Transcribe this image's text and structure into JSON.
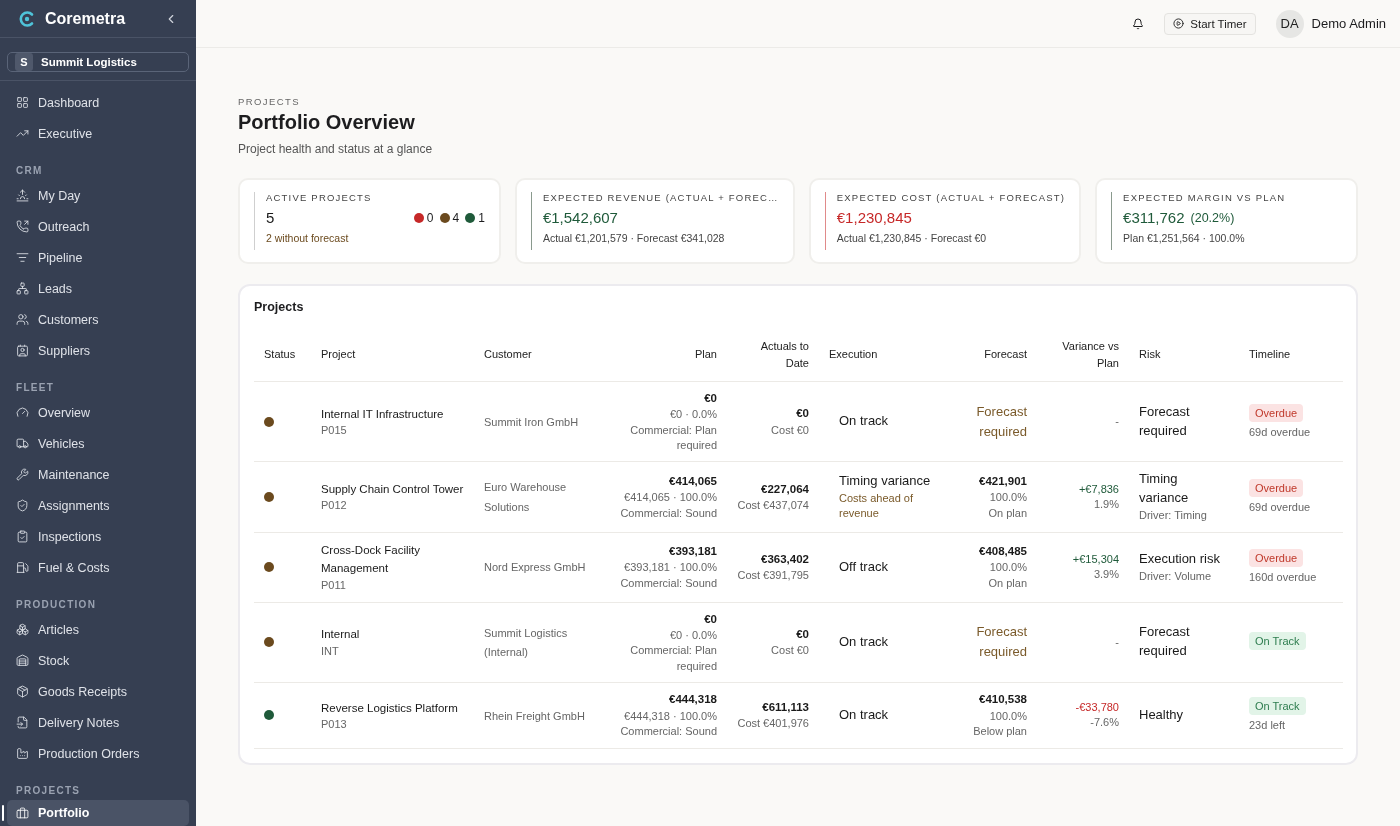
{
  "sidebar": {
    "brand": "Coremetra",
    "org": {
      "initial": "S",
      "name": "Summit Logistics"
    },
    "sections": [
      {
        "items": [
          {
            "label": "Dashboard",
            "selected": false
          },
          {
            "label": "Executive",
            "selected": false
          }
        ]
      },
      {
        "title": "CRM",
        "items": [
          {
            "label": "My Day",
            "selected": false
          },
          {
            "label": "Outreach",
            "selected": false
          },
          {
            "label": "Pipeline",
            "selected": false
          },
          {
            "label": "Leads",
            "selected": false
          },
          {
            "label": "Customers",
            "selected": false
          },
          {
            "label": "Suppliers",
            "selected": false
          }
        ]
      },
      {
        "title": "FLEET",
        "items": [
          {
            "label": "Overview",
            "selected": false
          },
          {
            "label": "Vehicles",
            "selected": false
          },
          {
            "label": "Maintenance",
            "selected": false
          },
          {
            "label": "Assignments",
            "selected": false
          },
          {
            "label": "Inspections",
            "selected": false
          },
          {
            "label": "Fuel & Costs",
            "selected": false
          }
        ]
      },
      {
        "title": "PRODUCTION",
        "items": [
          {
            "label": "Articles",
            "selected": false
          },
          {
            "label": "Stock",
            "selected": false
          },
          {
            "label": "Goods Receipts",
            "selected": false
          },
          {
            "label": "Delivery Notes",
            "selected": false
          },
          {
            "label": "Production Orders",
            "selected": false
          }
        ]
      },
      {
        "title": "PROJECTS",
        "items": [
          {
            "label": "Portfolio",
            "selected": true
          }
        ]
      }
    ]
  },
  "header": {
    "timer": "Start Timer",
    "user": {
      "initials": "DA",
      "name": "Demo Admin"
    }
  },
  "page": {
    "eyebrow": "PROJECTS",
    "title": "Portfolio Overview",
    "subtitle": "Project health and status at a glance"
  },
  "kpis": [
    {
      "kind": "count",
      "label": "ACTIVE PROJECTS",
      "value": "5",
      "dots": [
        {
          "color": "#c62828",
          "count": "0"
        },
        {
          "color": "#6b4a1e",
          "count": "4"
        },
        {
          "color": "#1f5a3a",
          "count": "1"
        }
      ],
      "note": "2 without forecast"
    },
    {
      "kind": "gain",
      "label": "EXPECTED REVENUE (ACTUAL + FOREC…",
      "value": "€1,542,607",
      "note": "Actual €1,201,579 · Forecast €341,028"
    },
    {
      "kind": "loss",
      "label": "EXPECTED COST (ACTUAL + FORECAST)",
      "value": "€1,230,845",
      "note": "Actual €1,230,845 · Forecast €0"
    },
    {
      "kind": "gain",
      "label": "EXPECTED MARGIN VS PLAN",
      "value": "€311,762",
      "extra": "(20.2%)",
      "note": "Plan €1,251,564 · 100.0%"
    }
  ],
  "table": {
    "title": "Projects",
    "columns": [
      "Status",
      "Project",
      "Customer",
      "Plan",
      "Actuals to Date",
      "Execution",
      "Forecast",
      "Variance vs Plan",
      "Risk",
      "Timeline"
    ],
    "rows": [
      {
        "color": "#6b4a1e",
        "project": "Internal IT Infrastructure",
        "code": "P015",
        "customer": "Summit Iron GmbH",
        "plan": {
          "total": "€0",
          "detail": "€0 · 0.0%",
          "commercial": "Commercial: Plan required"
        },
        "actuals": {
          "total": "€0",
          "cost": "Cost €0"
        },
        "execution": {
          "status": "On track"
        },
        "forecast": {
          "kind": "required",
          "text": "Forecast required"
        },
        "variance": {
          "kind": "none",
          "value": "-"
        },
        "risk": {
          "label": "Forecast required"
        },
        "timeline": {
          "badge": "Overdue",
          "kind": "overdue",
          "note": "69d overdue"
        }
      },
      {
        "color": "#6b4a1e",
        "project": "Supply Chain Control Tower",
        "code": "P012",
        "customer": "Euro Warehouse Solutions",
        "plan": {
          "total": "€414,065",
          "detail": "€414,065 · 100.0%",
          "commercial": "Commercial: Sound"
        },
        "actuals": {
          "total": "€227,064",
          "cost": "Cost €437,074"
        },
        "execution": {
          "status": "Timing variance",
          "note": "Costs ahead of revenue"
        },
        "forecast": {
          "kind": "value",
          "total": "€421,901",
          "pct": "100.0%",
          "note": "On plan"
        },
        "variance": {
          "kind": "gain",
          "value": "+€7,836",
          "pct": "1.9%"
        },
        "risk": {
          "label": "Timing variance",
          "driver": "Driver: Timing"
        },
        "timeline": {
          "badge": "Overdue",
          "kind": "overdue",
          "note": "69d overdue"
        }
      },
      {
        "color": "#6b4a1e",
        "project": "Cross-Dock Facility Management",
        "code": "P011",
        "customer": "Nord Express GmbH",
        "plan": {
          "total": "€393,181",
          "detail": "€393,181 · 100.0%",
          "commercial": "Commercial: Sound"
        },
        "actuals": {
          "total": "€363,402",
          "cost": "Cost €391,795"
        },
        "execution": {
          "status": "Off track"
        },
        "forecast": {
          "kind": "value",
          "total": "€408,485",
          "pct": "100.0%",
          "note": "On plan"
        },
        "variance": {
          "kind": "gain",
          "value": "+€15,304",
          "pct": "3.9%"
        },
        "risk": {
          "label": "Execution risk",
          "driver": "Driver: Volume"
        },
        "timeline": {
          "badge": "Overdue",
          "kind": "overdue",
          "note": "160d overdue"
        }
      },
      {
        "color": "#6b4a1e",
        "project": "Internal",
        "code": "INT",
        "customer": "Summit Logistics (Internal)",
        "plan": {
          "total": "€0",
          "detail": "€0 · 0.0%",
          "commercial": "Commercial: Plan required"
        },
        "actuals": {
          "total": "€0",
          "cost": "Cost €0"
        },
        "execution": {
          "status": "On track"
        },
        "forecast": {
          "kind": "required",
          "text": "Forecast required"
        },
        "variance": {
          "kind": "none",
          "value": "-"
        },
        "risk": {
          "label": "Forecast required"
        },
        "timeline": {
          "badge": "On Track",
          "kind": "ontrack"
        }
      },
      {
        "color": "#1f5a3a",
        "project": "Reverse Logistics Platform",
        "code": "P013",
        "customer": "Rhein Freight GmbH",
        "plan": {
          "total": "€444,318",
          "detail": "€444,318 · 100.0%",
          "commercial": "Commercial: Sound"
        },
        "actuals": {
          "total": "€611,113",
          "cost": "Cost €401,976"
        },
        "execution": {
          "status": "On track"
        },
        "forecast": {
          "kind": "value",
          "total": "€410,538",
          "pct": "100.0%",
          "note": "Below plan"
        },
        "variance": {
          "kind": "loss",
          "value": "-€33,780",
          "pct": "-7.6%"
        },
        "risk": {
          "label": "Healthy"
        },
        "timeline": {
          "badge": "On Track",
          "kind": "ontrack",
          "note": "23d left"
        }
      }
    ]
  }
}
